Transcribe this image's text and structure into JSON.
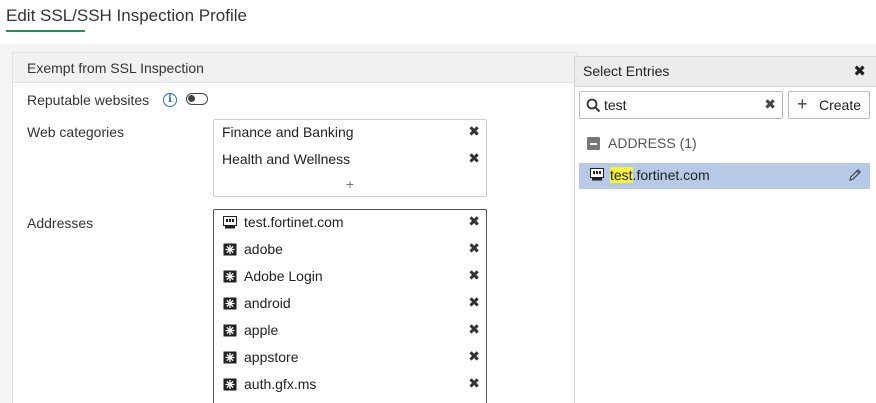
{
  "page": {
    "title": "Edit SSL/SSH Inspection Profile"
  },
  "section": {
    "title": "Exempt from SSL Inspection"
  },
  "reputable_websites": {
    "label": "Reputable websites",
    "info_icon": "info-icon",
    "enabled": false
  },
  "web_categories": {
    "label": "Web categories",
    "items": [
      "Finance and Banking",
      "Health and Wellness"
    ],
    "add_label": "+"
  },
  "addresses": {
    "label": "Addresses",
    "items": [
      {
        "name": "test.fortinet.com",
        "icon": "fqdn-address-icon"
      },
      {
        "name": "adobe",
        "icon": "address-group-icon"
      },
      {
        "name": "Adobe Login",
        "icon": "address-group-icon"
      },
      {
        "name": "android",
        "icon": "address-group-icon"
      },
      {
        "name": "apple",
        "icon": "address-group-icon"
      },
      {
        "name": "appstore",
        "icon": "address-group-icon"
      },
      {
        "name": "auth.gfx.ms",
        "icon": "address-group-icon"
      }
    ]
  },
  "select_entries": {
    "title": "Select Entries",
    "search_value": "test",
    "create_label": "Create",
    "group_label": "ADDRESS (1)",
    "entry": {
      "highlight": "test",
      "rest": ".fortinet.com",
      "selected": true
    }
  },
  "colors": {
    "selected_row": "#b6c9e6",
    "match_highlight": "#f7f23a",
    "accent_underline": "#2e8b57",
    "info_blue": "#2a6fb0"
  }
}
